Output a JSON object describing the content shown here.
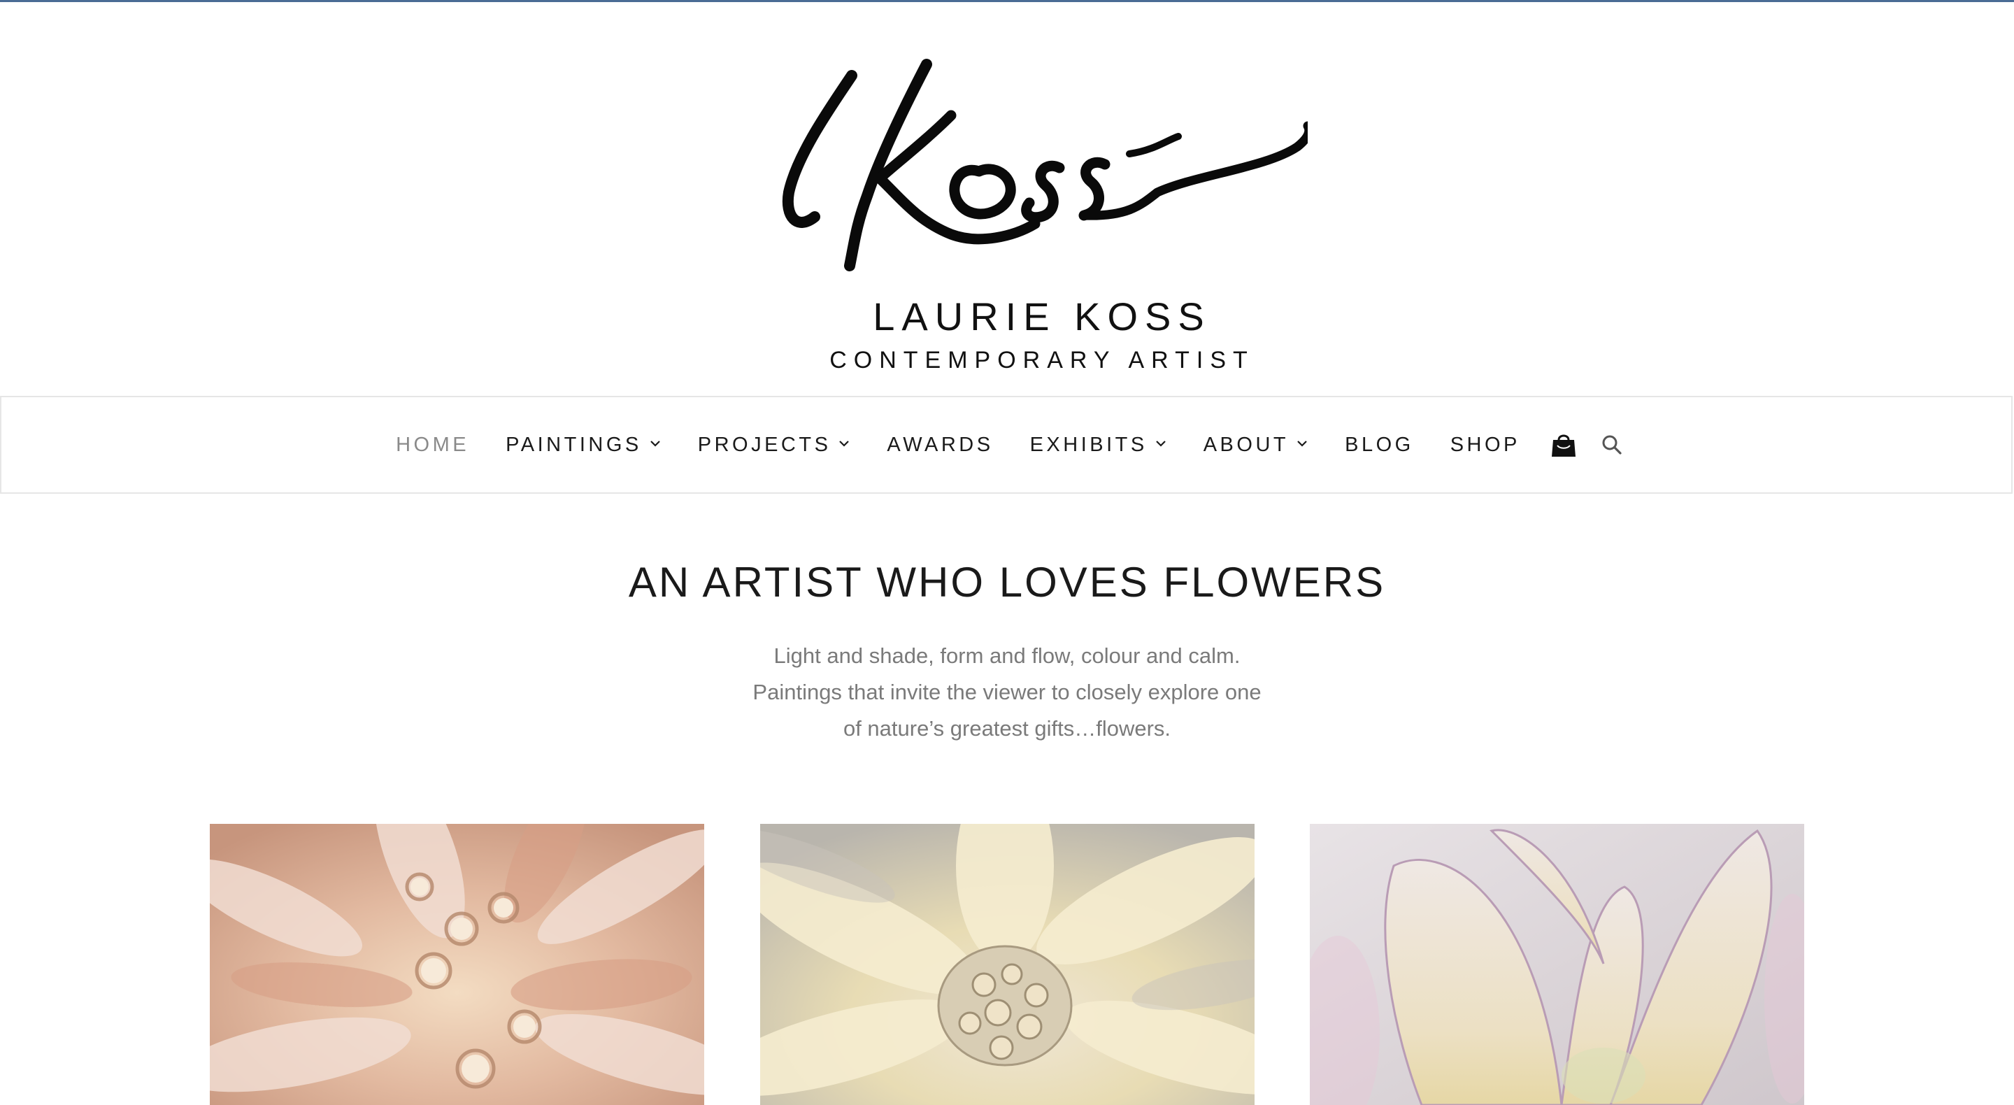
{
  "header": {
    "logo_name": "LAURIE KOSS",
    "logo_tagline": "CONTEMPORARY ARTIST"
  },
  "nav": {
    "items": [
      {
        "label": "HOME",
        "active": true,
        "dropdown": false
      },
      {
        "label": "PAINTINGS",
        "active": false,
        "dropdown": true
      },
      {
        "label": "PROJECTS",
        "active": false,
        "dropdown": true
      },
      {
        "label": "AWARDS",
        "active": false,
        "dropdown": false
      },
      {
        "label": "EXHIBITS",
        "active": false,
        "dropdown": true
      },
      {
        "label": "ABOUT",
        "active": false,
        "dropdown": true
      },
      {
        "label": "BLOG",
        "active": false,
        "dropdown": false
      },
      {
        "label": "SHOP",
        "active": false,
        "dropdown": false
      }
    ],
    "icons": [
      "shopping-bag-icon",
      "search-icon"
    ]
  },
  "hero": {
    "title": "AN ARTIST WHO LOVES FLOWERS",
    "lines": [
      "Light and shade, form and flow, colour and calm.",
      "Paintings that invite the viewer to closely explore one",
      "of nature’s greatest gifts…flowers."
    ]
  },
  "gallery": {
    "paintings": [
      {
        "palette": "peach-pink dahlia"
      },
      {
        "palette": "cream-yellow dahlia"
      },
      {
        "palette": "lavender-cream petals"
      }
    ]
  },
  "colors": {
    "accent_line": "#4a6c95",
    "nav_text": "#1a1a1a",
    "nav_active": "#8a8a8a",
    "subtitle_text": "#7a7a7a"
  }
}
